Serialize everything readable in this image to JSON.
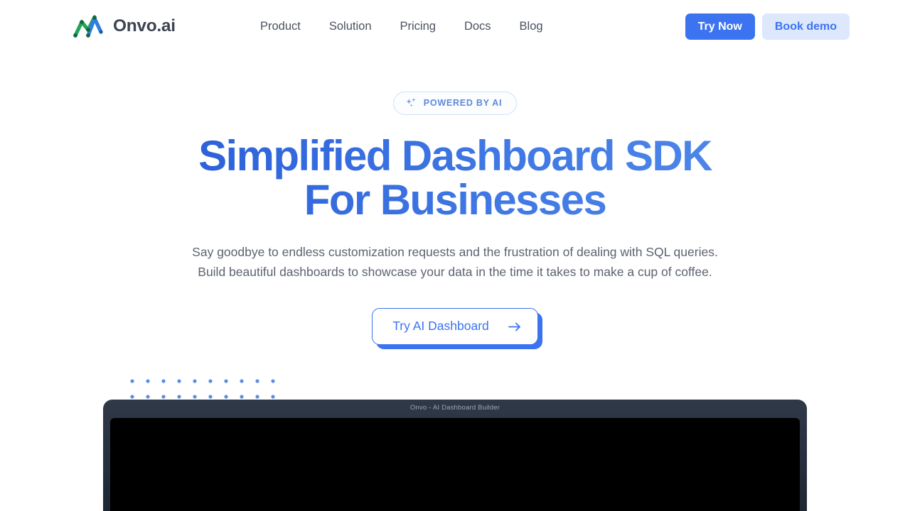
{
  "brand": {
    "name": "Onvo.ai",
    "logo_icon": "onvo-zigzag-chart-logo",
    "colors": {
      "green": "#22a35a",
      "blue": "#2f7fe0",
      "text": "#3d4451"
    }
  },
  "nav": {
    "items": [
      {
        "label": "Product"
      },
      {
        "label": "Solution"
      },
      {
        "label": "Pricing"
      },
      {
        "label": "Docs"
      },
      {
        "label": "Blog"
      }
    ]
  },
  "header_actions": {
    "try_now_label": "Try Now",
    "book_demo_label": "Book demo",
    "primary_color": "#3b73f0",
    "secondary_bg": "#dde8fc"
  },
  "hero": {
    "badge": {
      "text": "POWERED BY AI",
      "icon": "sparkles-icon",
      "border_color": "#cfe0f8",
      "text_color": "#5e88d8"
    },
    "headline_line1": "Simplified Dashboard SDK",
    "headline_line2": "For Businesses",
    "headline_gradient_from": "#2a5cd7",
    "headline_gradient_to": "#538cec",
    "subtitle": "Say goodbye to endless customization requests and the frustration of dealing with SQL queries. Build beautiful dashboards to showcase your data in the time it takes to make a cup of coffee.",
    "cta": {
      "label": "Try AI Dashboard",
      "icon": "arrow-right-icon",
      "color": "#3b73f0"
    }
  },
  "decoration": {
    "dot_grid": {
      "columns": 10,
      "rows": 2,
      "spacing": 22,
      "dot_radius": 2.6,
      "color": "#5d8de0"
    }
  },
  "mockup": {
    "window_title": "Onvo - AI Dashboard Builder",
    "frame_color": "#2a3442",
    "screen_color": "#000000"
  }
}
